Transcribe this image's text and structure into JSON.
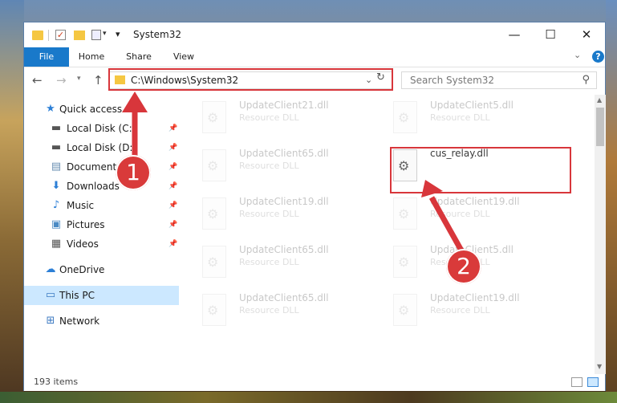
{
  "window": {
    "title": "System32",
    "controls": {
      "minimize": "—",
      "maximize": "☐",
      "close": "✕"
    }
  },
  "ribbon": {
    "tabs": [
      "File",
      "Home",
      "Share",
      "View"
    ],
    "help": "?"
  },
  "address_bar": {
    "path": "C:\\Windows\\System32",
    "search_placeholder": "Search System32"
  },
  "sidebar": {
    "items": [
      {
        "label": "Quick access",
        "icon": "star-icon",
        "pinned": false
      },
      {
        "label": "Local Disk (C:)",
        "icon": "drive-icon",
        "pinned": true
      },
      {
        "label": "Local Disk (D:)",
        "icon": "drive-icon",
        "pinned": true
      },
      {
        "label": "Documents",
        "icon": "documents-icon",
        "pinned": true
      },
      {
        "label": "Downloads",
        "icon": "download-icon",
        "pinned": true
      },
      {
        "label": "Music",
        "icon": "music-icon",
        "pinned": true
      },
      {
        "label": "Pictures",
        "icon": "pictures-icon",
        "pinned": true
      },
      {
        "label": "Videos",
        "icon": "videos-icon",
        "pinned": true
      },
      {
        "label": "OneDrive",
        "icon": "cloud-icon",
        "pinned": false
      },
      {
        "label": "This PC",
        "icon": "computer-icon",
        "pinned": false,
        "selected": true
      },
      {
        "label": "Network",
        "icon": "network-icon",
        "pinned": false
      }
    ]
  },
  "files": [
    {
      "name": "UpdateClient21.dll",
      "type": "Resource DLL",
      "faded": true
    },
    {
      "name": "UpdateClient5.dll",
      "type": "Resource DLL",
      "faded": true
    },
    {
      "name": "UpdateClient65.dll",
      "type": "Resource DLL",
      "faded": true
    },
    {
      "name": "cus_relay.dll",
      "type": "",
      "faded": false
    },
    {
      "name": "UpdateClient19.dll",
      "type": "Resource DLL",
      "faded": true
    },
    {
      "name": "UpdateClient19.dll",
      "type": "Resource DLL",
      "faded": true
    },
    {
      "name": "UpdateClient65.dll",
      "type": "Resource DLL",
      "faded": true
    },
    {
      "name": "UpdateClient5.dll",
      "type": "Resource DLL",
      "faded": true
    },
    {
      "name": "UpdateClient65.dll",
      "type": "Resource DLL",
      "faded": true
    },
    {
      "name": "UpdateClient19.dll",
      "type": "Resource DLL",
      "faded": true
    }
  ],
  "status": {
    "item_count": "193 items"
  },
  "annotations": {
    "step1": "1",
    "step2": "2",
    "color": "#d8363b"
  }
}
